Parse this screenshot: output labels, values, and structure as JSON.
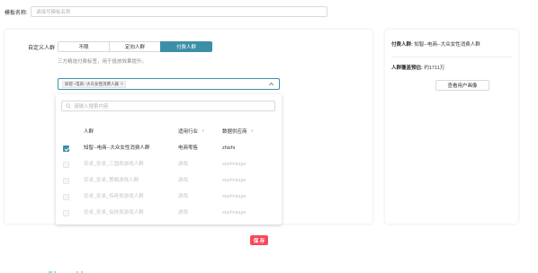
{
  "template": {
    "label": "模板名称:",
    "placeholder": "请填写模板名称"
  },
  "crowd": {
    "label": "自定义人群",
    "options": [
      "不限",
      "定向人群",
      "付费人群"
    ],
    "active_index": 2,
    "hint": "三方精选付费标签，用于投放效果提升。"
  },
  "selected_tag": "知智--电商--大众女性消费人群",
  "dropdown": {
    "search_placeholder": "请输入搜索内容",
    "columns": {
      "name": "人群",
      "industry": "适用行业",
      "supplier": "数据供应商"
    },
    "rows": [
      {
        "name": "知智--电商--大众女性消费人群",
        "industry": "电商零售",
        "supplier": "zhizhi",
        "checked": true,
        "enabled": true
      },
      {
        "name": "安卓_安卓_三国类游戏人群",
        "industry": "游戏",
        "supplier": "starlinkage",
        "checked": false,
        "enabled": false
      },
      {
        "name": "安卓_安卓_策略游戏人群",
        "industry": "游戏",
        "supplier": "starlinkage",
        "checked": false,
        "enabled": false
      },
      {
        "name": "安卓_安卓_传奇类游戏人群",
        "industry": "游戏",
        "supplier": "starlinkage",
        "checked": false,
        "enabled": false
      },
      {
        "name": "安卓_安卓_仙侠类游戏人群",
        "industry": "游戏",
        "supplier": "starlinkage",
        "checked": false,
        "enabled": false
      }
    ]
  },
  "side": {
    "title_label": "付费人群:",
    "title_value": "知智--电商--大众女性消费人群",
    "reach_label": "人群覆盖预估:",
    "reach_value": "约1711万",
    "portrait_button": "查看用户画像"
  },
  "save_button": "保 存",
  "colors": {
    "accent": "#3d8fa8",
    "save": "#f5495d"
  }
}
